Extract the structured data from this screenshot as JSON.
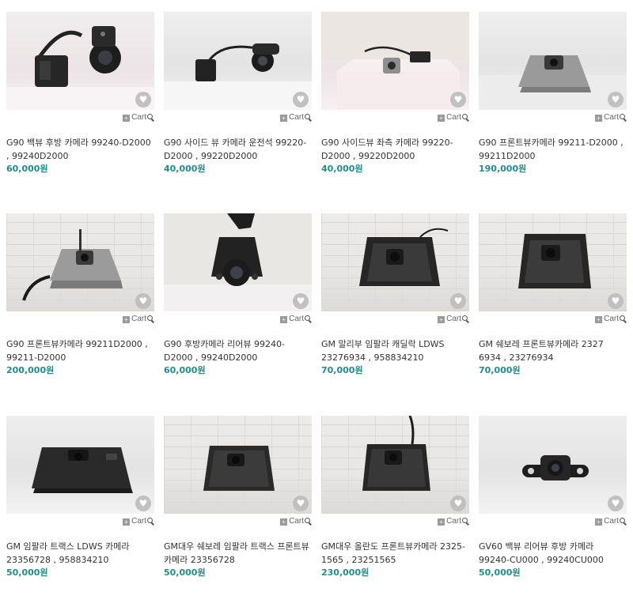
{
  "cart_label": "Cart",
  "products": [
    {
      "name": "G90 백뷰 후방 카메라 99240-D2000 , 99240D2000",
      "price": "60,000원",
      "image": "rear-camera-with-cable"
    },
    {
      "name": "G90 사이드 뷰 카메라 운전석 99220-D2000 , 99220D2000",
      "price": "40,000원",
      "image": "side-camera-with-cable"
    },
    {
      "name": "G90 사이드뷰 좌측 카메라 99220-D2000 , 99220D2000",
      "price": "40,000원",
      "image": "side-camera-small"
    },
    {
      "name": "G90 프론트뷰카메라 99211-D2000 , 99211D2000",
      "price": "190,000원",
      "image": "front-camera-silver"
    },
    {
      "name": "G90 프론트뷰카메라 99211D2000 , 99211-D2000",
      "price": "200,000원",
      "image": "front-camera-silver-cable"
    },
    {
      "name": "G90 후방카메라 리어뷰 99240-D2000 , 99240D2000",
      "price": "60,000원",
      "image": "rear-camera-closeup"
    },
    {
      "name": "GM 말리부 임팔라 캐딜락 LDWS 23276934 , 958834210",
      "price": "70,000원",
      "image": "ldws-camera-bracket"
    },
    {
      "name": "GM 쉐보레 프론트뷰카메라 2327 6934 , 23276934",
      "price": "70,000원",
      "image": "front-camera-bracket"
    },
    {
      "name": "GM 임팔라 트랙스 LDWS 카메라 23356728 , 958834210",
      "price": "50,000원",
      "image": "ldws-camera-black"
    },
    {
      "name": "GM대우 쉐보레 임팔라 트랙스 프론트뷰카메라 23356728",
      "price": "50,000원",
      "image": "front-camera-black"
    },
    {
      "name": "GM대우 올란도 프론트뷰카메라 2325-1565 , 23251565",
      "price": "230,000원",
      "image": "front-camera-black-cable"
    },
    {
      "name": "GV60 백뷰 리어뷰 후방 카메라 99240-CU000 , 99240CU000",
      "price": "50,000원",
      "image": "rear-camera-small-black"
    }
  ]
}
